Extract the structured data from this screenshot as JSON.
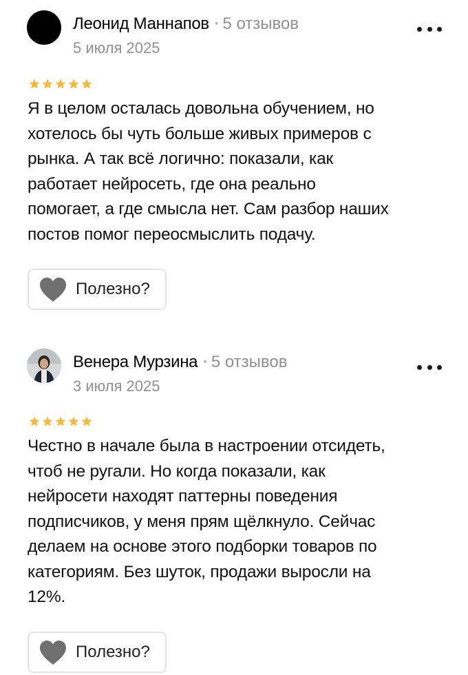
{
  "reviews": [
    {
      "author": "Леонид Маннапов",
      "separator": "•",
      "reviews_count": "5 отзывов",
      "date": "5 июля 2025",
      "rating": 5,
      "avatar_icon": "avatar-black-circle",
      "text_lines": [
        "Я в целом осталась довольна обучением, но",
        "хотелось бы чуть больше живых примеров с",
        "рынка. А так всё логично: показали, как",
        "работает нейросеть, где она реально",
        "помогает, а где смысла нет. Сам разбор наших",
        "постов помог переосмыслить подачу."
      ],
      "helpful_label": "Полезно?"
    },
    {
      "author": "Венера Мурзина",
      "separator": "•",
      "reviews_count": "5 отзывов",
      "date": "3 июля 2025",
      "rating": 5,
      "avatar_icon": "avatar-photo",
      "text_lines": [
        "Честно в начале была в настроении отсидеть,",
        "чтоб не ругали. Но когда показали, как",
        "нейросети находят паттерны поведения",
        "подписчиков, у меня прям щёлкнуло. Сейчас",
        "делаем на основе этого подборки товаров по",
        "категориям. Без шуток, продажи выросли на",
        "12%."
      ],
      "helpful_label": "Полезно?"
    }
  ],
  "colors": {
    "star": "#f6b93b",
    "muted_text": "#8f8f8f",
    "heart": "#6f6f6f",
    "button_border": "#e3e3e3"
  },
  "icons": {
    "more": "more-dots-icon",
    "star": "star-icon",
    "heart": "heart-icon"
  }
}
